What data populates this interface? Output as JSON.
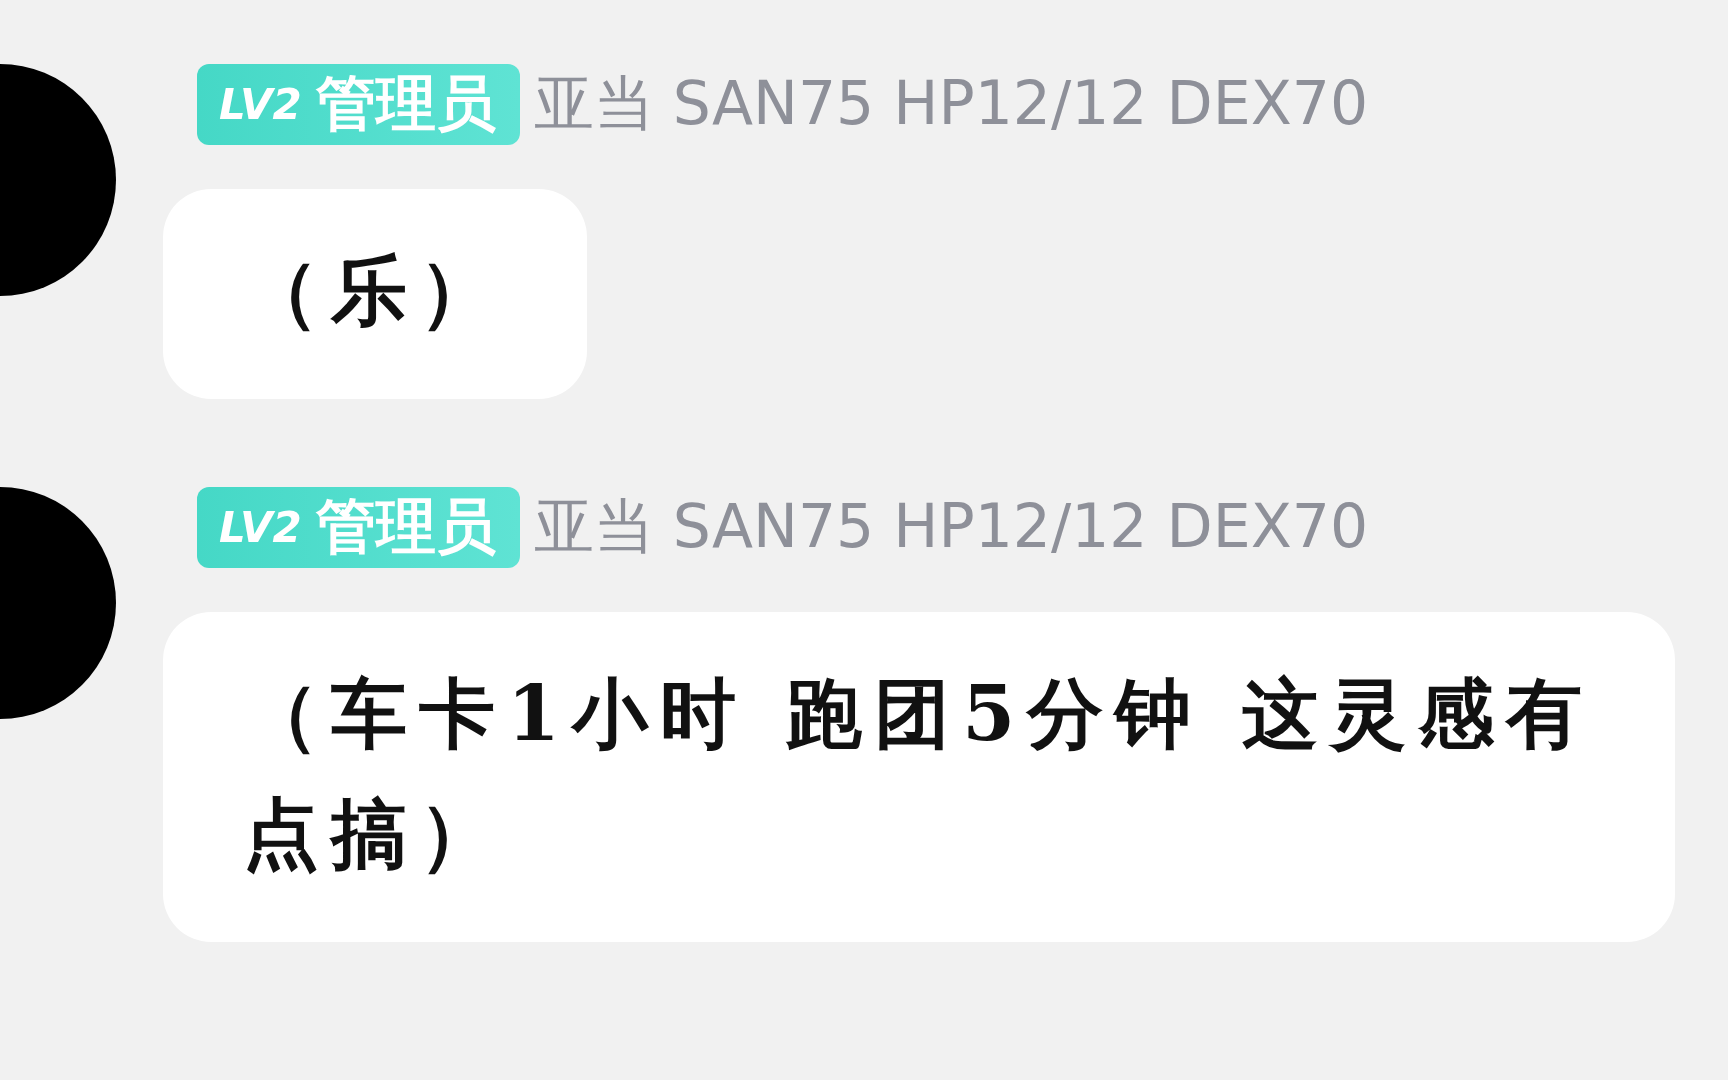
{
  "messages": [
    {
      "badge": {
        "level": "LV2",
        "role": "管理员"
      },
      "sender": "亚当 SAN75 HP12/12 DEX70",
      "text": "（乐）"
    },
    {
      "badge": {
        "level": "LV2",
        "role": "管理员"
      },
      "sender": "亚当 SAN75 HP12/12 DEX70",
      "text": "（车卡1小时 跑团5分钟 这灵感有点搞）"
    }
  ]
}
